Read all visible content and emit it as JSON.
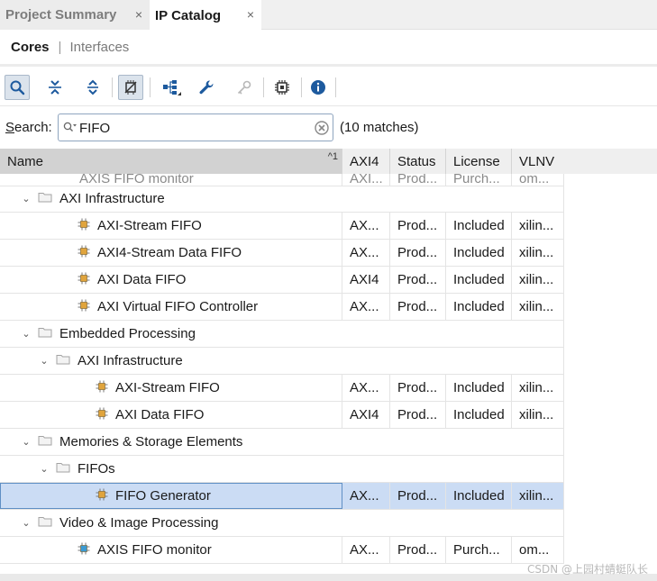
{
  "tabs": [
    {
      "label": "Project Summary",
      "close": "×"
    },
    {
      "label": "IP Catalog",
      "close": "×"
    }
  ],
  "subtabs": {
    "cores": "Cores",
    "separator": "|",
    "interfaces": "Interfaces"
  },
  "toolbar": {
    "icons": [
      "search-icon",
      "collapse-all-icon",
      "expand-all-icon",
      "customize-ip-icon",
      "hierarchy-icon",
      "wrench-icon",
      "key-icon",
      "chip-icon",
      "info-icon"
    ]
  },
  "search": {
    "label_prefix": "S",
    "label_rest": "earch:",
    "value": "FIFO",
    "matches": "(10 matches)"
  },
  "table": {
    "columns": [
      {
        "key": "name",
        "label": "Name",
        "sort": "^1"
      },
      {
        "key": "axi4",
        "label": "AXI4"
      },
      {
        "key": "status",
        "label": "Status"
      },
      {
        "key": "license",
        "label": "License"
      },
      {
        "key": "vlnv",
        "label": "VLNV"
      }
    ],
    "partial_row": {
      "name": "AXIS FIFO monitor",
      "axi4": "AXI...",
      "status": "Prod...",
      "license": "Purch...",
      "vlnv": "om..."
    },
    "rows": [
      {
        "type": "group",
        "depth": 1,
        "name": "AXI Infrastructure"
      },
      {
        "type": "item",
        "depth": 2,
        "name": "AXI-Stream FIFO",
        "axi4": "AX...",
        "status": "Prod...",
        "license": "Included",
        "vlnv": "xilin...",
        "icon": "orange"
      },
      {
        "type": "item",
        "depth": 2,
        "name": "AXI4-Stream Data FIFO",
        "axi4": "AX...",
        "status": "Prod...",
        "license": "Included",
        "vlnv": "xilin...",
        "icon": "orange"
      },
      {
        "type": "item",
        "depth": 2,
        "name": "AXI Data FIFO",
        "axi4": "AXI4",
        "status": "Prod...",
        "license": "Included",
        "vlnv": "xilin...",
        "icon": "orange"
      },
      {
        "type": "item",
        "depth": 2,
        "name": "AXI Virtual FIFO Controller",
        "axi4": "AX...",
        "status": "Prod...",
        "license": "Included",
        "vlnv": "xilin...",
        "icon": "orange"
      },
      {
        "type": "group",
        "depth": 1,
        "name": "Embedded Processing"
      },
      {
        "type": "group",
        "depth": 2,
        "name": "AXI Infrastructure"
      },
      {
        "type": "item",
        "depth": 3,
        "name": "AXI-Stream FIFO",
        "axi4": "AX...",
        "status": "Prod...",
        "license": "Included",
        "vlnv": "xilin...",
        "icon": "orange"
      },
      {
        "type": "item",
        "depth": 3,
        "name": "AXI Data FIFO",
        "axi4": "AXI4",
        "status": "Prod...",
        "license": "Included",
        "vlnv": "xilin...",
        "icon": "orange"
      },
      {
        "type": "group",
        "depth": 1,
        "name": "Memories & Storage Elements"
      },
      {
        "type": "group",
        "depth": 2,
        "name": "FIFOs"
      },
      {
        "type": "item",
        "depth": 3,
        "name": "FIFO Generator",
        "axi4": "AX...",
        "status": "Prod...",
        "license": "Included",
        "vlnv": "xilin...",
        "icon": "orange",
        "selected": true
      },
      {
        "type": "group",
        "depth": 1,
        "name": "Video & Image Processing"
      },
      {
        "type": "item",
        "depth": 2,
        "name": "AXIS FIFO monitor",
        "axi4": "AX...",
        "status": "Prod...",
        "license": "Purch...",
        "vlnv": "om...",
        "icon": "blue"
      }
    ]
  },
  "colors": {
    "selected_row": "#cbdcf4",
    "chip_orange": "#e0a43c",
    "chip_blue": "#3b9ad3",
    "accent": "#1a5fb4"
  },
  "watermark": "CSDN @上园村蜻蜓队长"
}
